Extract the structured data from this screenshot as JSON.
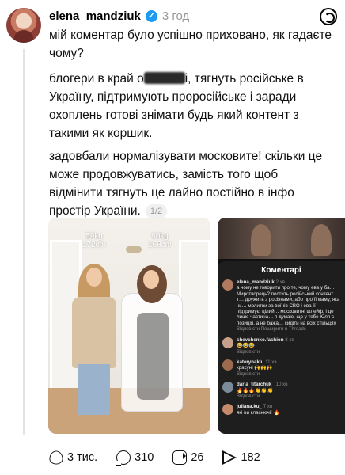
{
  "post": {
    "username": "elena_mandziuk",
    "time": "3 год",
    "text1": "мій коментар було успішно приховано, як гадаєте чому?",
    "text2_before": "блогери в край о",
    "text2_after": "і, тягнуть російське в Україну, підтримують проросійське і заради охоплень готові знімати будь який контент з такими як коршик.",
    "text3": "задовбали нормалізувати московите! скільки це може продовжуватись, замість того щоб відмінити тягнуть це лайно постійно в інфо простір України.",
    "pager": "1/2"
  },
  "media": {
    "label1_line1": "59kg",
    "label1_line2": "172cm",
    "label2_line1": "80kg",
    "label2_line2": "168cm"
  },
  "comments_panel": {
    "title": "Коментарі",
    "comments": [
      {
        "user": "elena_mandziuk",
        "meta": "2 хв",
        "text": "а чому не говорити про те, чому ева у ба… Миротворець? постить російський контент т… дружить з росіянами, або про її маму, яка чь… молитви за воїнів СВО і ева її підтримує. цілий… московитні шлейф, і це лише частина… я думаю, що у тебе Юля є позиція, а не бажа… сидіти на всіх стільцях заради охоплень",
        "replies": "Відповісти   Поширити в Threads"
      },
      {
        "user": "shevchenko.fashion",
        "meta": "8 хв",
        "text": "😂😂😂",
        "replies": "Відповісти"
      },
      {
        "user": "katerynaklu",
        "meta": "11 хв",
        "text": "красуні 🙌🙌🙌",
        "replies": "Відповісти"
      },
      {
        "user": "daria_titarchuk_",
        "meta": "10 хв",
        "text": "🔥🔥🔥👏👏👏",
        "replies": "Відповісти"
      },
      {
        "user": "juliana.ku_",
        "meta": "7 хв",
        "text": "які ви класнючі! 🔥",
        "replies": ""
      }
    ]
  },
  "actions": {
    "likes": "3 тис.",
    "comments": "310",
    "reposts": "26",
    "shares": "182"
  }
}
